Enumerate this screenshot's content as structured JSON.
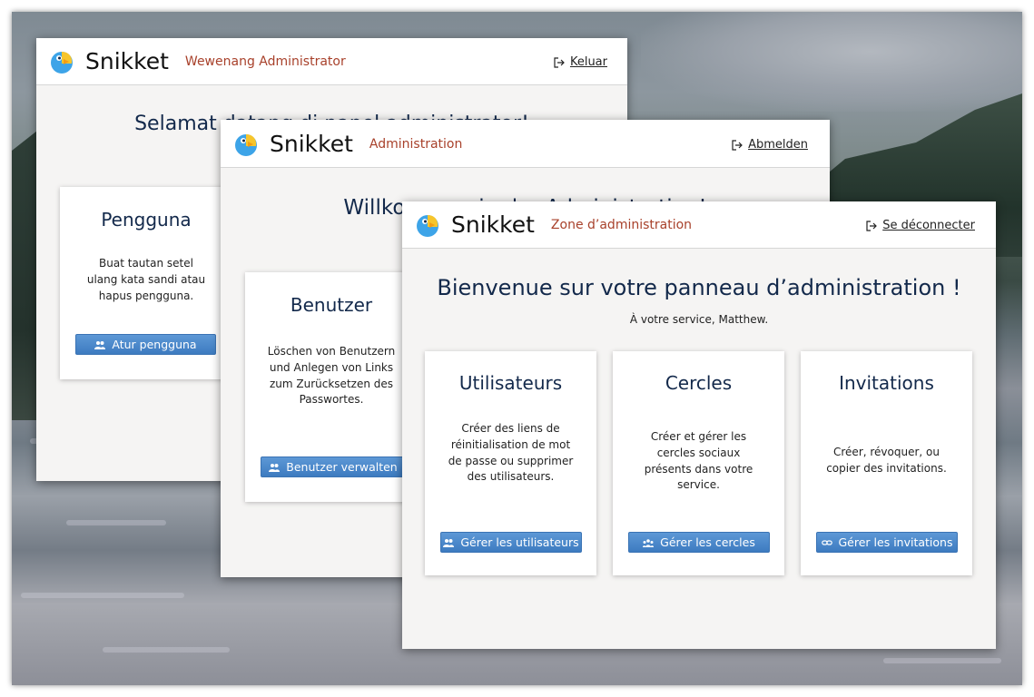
{
  "brand": {
    "app_name": "Snikket",
    "logo_icon": "snikket-parrot-icon"
  },
  "window_indonesian": {
    "zone_label": "Wewenang Administrator",
    "logout_label": "Keluar",
    "welcome": "Selamat datang di panel administrator!",
    "card_users": {
      "title": "Pengguna",
      "description": "Buat tautan setel ulang kata sandi atau hapus pengguna.",
      "button": "Atur pengguna"
    }
  },
  "window_german": {
    "zone_label": "Administration",
    "logout_label": "Abmelden",
    "welcome": "Willkommen in der Administration!",
    "card_users": {
      "title": "Benutzer",
      "description": "Löschen von Benutzern und Anlegen von Links zum Zurücksetzen des Passwortes.",
      "button": "Benutzer verwalten"
    }
  },
  "window_french": {
    "zone_label": "Zone d’administration",
    "logout_label": "Se déconnecter",
    "welcome": "Bienvenue sur votre panneau d’administration !",
    "subtitle": "À votre service, Matthew.",
    "cards": [
      {
        "title": "Utilisateurs",
        "description": "Créer des liens de réinitialisation de mot de passe ou supprimer des utilisateurs.",
        "button": "Gérer les utilisateurs",
        "icon": "users-icon"
      },
      {
        "title": "Cercles",
        "description": "Créer et gérer les cercles sociaux présents dans votre service.",
        "button": "Gérer les cercles",
        "icon": "circles-icon"
      },
      {
        "title": "Invitations",
        "description": "Créer, révoquer, ou copier des invitations.",
        "button": "Gérer les invitations",
        "icon": "link-icon"
      }
    ]
  },
  "colors": {
    "accent": "#4a86c8",
    "zone_label": "#a8412b",
    "heading": "#13294b",
    "panel_bg": "#f5f4f3"
  }
}
